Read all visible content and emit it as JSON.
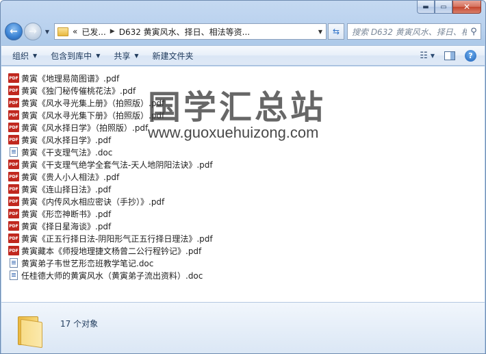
{
  "window": {
    "caption": {
      "minimize": "▬",
      "maximize": "▭",
      "close": "✕"
    }
  },
  "nav": {
    "back_glyph": "←",
    "forward_glyph": "→",
    "breadcrumb_overflow": "«",
    "breadcrumb": [
      "已发...",
      "D632 黄寅风水、择日、相法等资..."
    ],
    "search_placeholder": "搜索 D632 黄寅风水、择日、相法等..."
  },
  "toolbar": {
    "organize": "组织",
    "include_in_library": "包含到库中",
    "share": "共享",
    "new_folder": "新建文件夹"
  },
  "files": [
    {
      "name": "黄寅《地理易简图谱》.pdf",
      "type": "pdf"
    },
    {
      "name": "黄寅《独门秘传催桃花法》.pdf",
      "type": "pdf"
    },
    {
      "name": "黄寅《风水寻光集上册》（拍照版）.pdf",
      "type": "pdf"
    },
    {
      "name": "黄寅《风水寻光集下册》（拍照版）.pdf",
      "type": "pdf"
    },
    {
      "name": "黄寅《风水择日学》（拍照版）.pdf",
      "type": "pdf"
    },
    {
      "name": "黄寅《风水择日学》.pdf",
      "type": "pdf"
    },
    {
      "name": "黄寅《干支理气法》.doc",
      "type": "doc"
    },
    {
      "name": "黄寅《干支理气绝学全套气法-天人地阴阳法诀》.pdf",
      "type": "pdf"
    },
    {
      "name": "黄寅《贵人小人相法》.pdf",
      "type": "pdf"
    },
    {
      "name": "黄寅《连山择日法》.pdf",
      "type": "pdf"
    },
    {
      "name": "黄寅《内传风水相应密诀（手抄）》.pdf",
      "type": "pdf"
    },
    {
      "name": "黄寅《形峦神断书》.pdf",
      "type": "pdf"
    },
    {
      "name": "黄寅《择日星海谈》.pdf",
      "type": "pdf"
    },
    {
      "name": "黄寅《正五行择日法-阴阳形气正五行择日理法》.pdf",
      "type": "pdf"
    },
    {
      "name": "黄寅藏本《师授地理捷文杨曾二公行程钤记》.pdf",
      "type": "pdf"
    },
    {
      "name": "黄寅弟子韦世艺形峦班教学笔记.doc",
      "type": "doc"
    },
    {
      "name": "任桂德大师的黄寅风水（黄寅弟子流出资料）.doc",
      "type": "doc"
    }
  ],
  "pdf_icon_label": "PDF",
  "watermark": {
    "cn": "国学汇总站",
    "en": "www.guoxuehuizong.com"
  },
  "details": {
    "count": "17 个对象"
  }
}
